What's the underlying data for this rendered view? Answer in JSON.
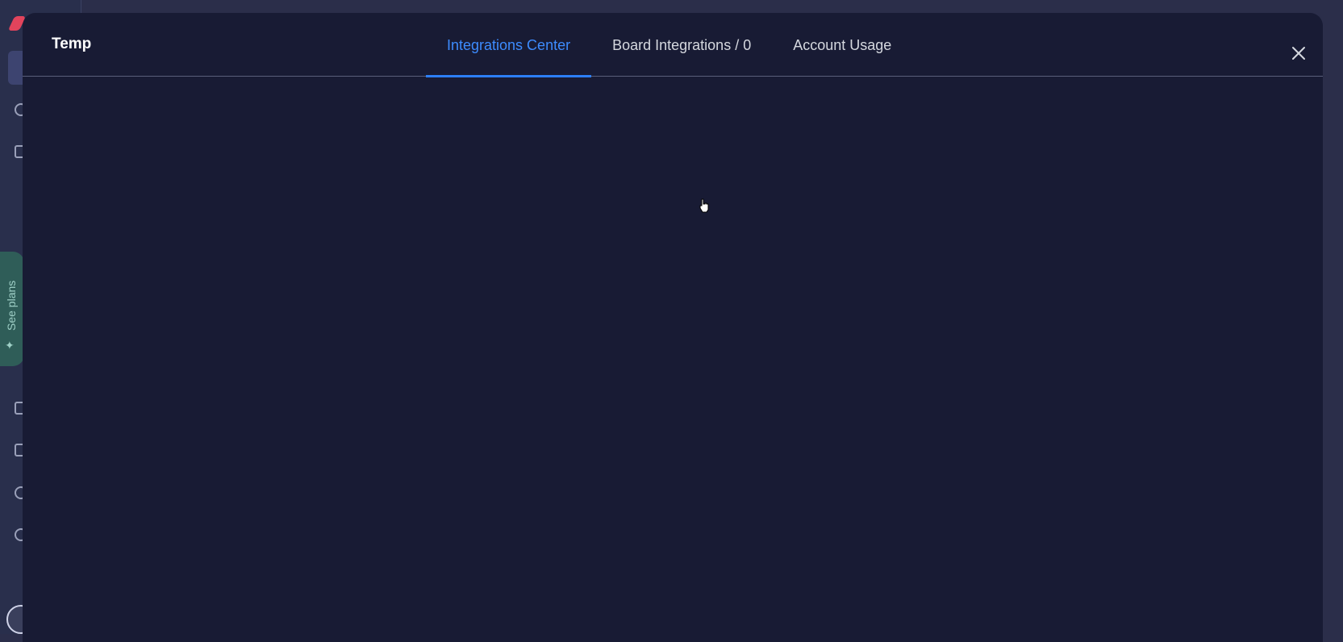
{
  "background": {
    "sidebar_promo_label": "See plans"
  },
  "modal": {
    "title": "Temp",
    "tabs": [
      {
        "label": "Integrations Center",
        "active": true
      },
      {
        "label": "Board Integrations / 0",
        "active": false
      },
      {
        "label": "Account Usage",
        "active": false
      }
    ],
    "close_icon": "close-icon"
  },
  "colors": {
    "modal_bg": "#181b34",
    "active_tab": "#3d8cff",
    "tab_underline": "#2d7ff9",
    "tab_text": "#d5d8df"
  }
}
